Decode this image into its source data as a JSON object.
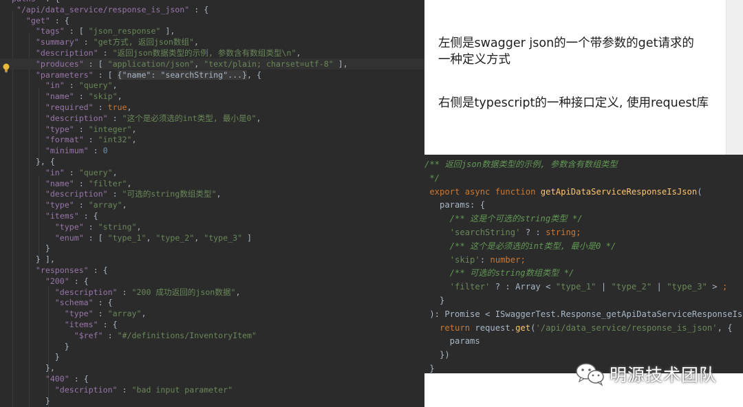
{
  "json_editor": {
    "lines": [
      [
        [
          "k",
          "\"paths\""
        ],
        [
          "p",
          " : {"
        ]
      ],
      [
        [
          "k",
          "  \"/api/data_service/response_is_json\""
        ],
        [
          "p",
          " : {"
        ]
      ],
      [
        [
          "k",
          "    \"get\""
        ],
        [
          "p",
          " : {"
        ]
      ],
      [
        [
          "k",
          "      \"tags\""
        ],
        [
          "p",
          " : [ "
        ],
        [
          "s",
          "\"json_response\""
        ],
        [
          "p",
          " ],"
        ]
      ],
      [
        [
          "k",
          "      \"summary\""
        ],
        [
          "p",
          " : "
        ],
        [
          "s",
          "\"get方式, 返回json数组\""
        ],
        [
          "p",
          ","
        ]
      ],
      [
        [
          "k",
          "      \"description\""
        ],
        [
          "p",
          " : "
        ],
        [
          "s",
          "\"返回json数据类型的示例, 参数含有数组类型\\n\""
        ],
        [
          "p",
          ","
        ]
      ],
      [
        [
          "k",
          "      \"produces\""
        ],
        [
          "p",
          " : [ "
        ],
        [
          "s",
          "\"application/json\""
        ],
        [
          "p",
          ", "
        ],
        [
          "s",
          "\"text/plain; charset=utf-8\""
        ],
        [
          "p",
          " ],"
        ]
      ],
      [
        [
          "k",
          "      \"parameters\""
        ],
        [
          "p",
          " : [ "
        ],
        [
          "f",
          "{\"name\": \"searchString\"...}"
        ],
        [
          "p",
          ", {"
        ]
      ],
      [
        [
          "k",
          "        \"in\""
        ],
        [
          "p",
          " : "
        ],
        [
          "s",
          "\"query\""
        ],
        [
          "p",
          ","
        ]
      ],
      [
        [
          "k",
          "        \"name\""
        ],
        [
          "p",
          " : "
        ],
        [
          "s",
          "\"skip\""
        ],
        [
          "p",
          ","
        ]
      ],
      [
        [
          "k",
          "        \"required\""
        ],
        [
          "p",
          " : "
        ],
        [
          "b",
          "true"
        ],
        [
          "p",
          ","
        ]
      ],
      [
        [
          "k",
          "        \"description\""
        ],
        [
          "p",
          " : "
        ],
        [
          "s",
          "\"这个是必须选的int类型, 最小是0\""
        ],
        [
          "p",
          ","
        ]
      ],
      [
        [
          "k",
          "        \"type\""
        ],
        [
          "p",
          " : "
        ],
        [
          "s",
          "\"integer\""
        ],
        [
          "p",
          ","
        ]
      ],
      [
        [
          "k",
          "        \"format\""
        ],
        [
          "p",
          " : "
        ],
        [
          "s",
          "\"int32\""
        ],
        [
          "p",
          ","
        ]
      ],
      [
        [
          "k",
          "        \"minimum\""
        ],
        [
          "p",
          " : "
        ],
        [
          "n",
          "0"
        ]
      ],
      [
        [
          "p",
          "      }, {"
        ]
      ],
      [
        [
          "k",
          "        \"in\""
        ],
        [
          "p",
          " : "
        ],
        [
          "s",
          "\"query\""
        ],
        [
          "p",
          ","
        ]
      ],
      [
        [
          "k",
          "        \"name\""
        ],
        [
          "p",
          " : "
        ],
        [
          "s",
          "\"filter\""
        ],
        [
          "p",
          ","
        ]
      ],
      [
        [
          "k",
          "        \"description\""
        ],
        [
          "p",
          " : "
        ],
        [
          "s",
          "\"可选的string数组类型\""
        ],
        [
          "p",
          ","
        ]
      ],
      [
        [
          "k",
          "        \"type\""
        ],
        [
          "p",
          " : "
        ],
        [
          "s",
          "\"array\""
        ],
        [
          "p",
          ","
        ]
      ],
      [
        [
          "k",
          "        \"items\""
        ],
        [
          "p",
          " : {"
        ]
      ],
      [
        [
          "k",
          "          \"type\""
        ],
        [
          "p",
          " : "
        ],
        [
          "s",
          "\"string\""
        ],
        [
          "p",
          ","
        ]
      ],
      [
        [
          "k",
          "          \"enum\""
        ],
        [
          "p",
          " : [ "
        ],
        [
          "s",
          "\"type_1\""
        ],
        [
          "p",
          ", "
        ],
        [
          "s",
          "\"type_2\""
        ],
        [
          "p",
          ", "
        ],
        [
          "s",
          "\"type_3\""
        ],
        [
          "p",
          " ]"
        ]
      ],
      [
        [
          "p",
          "        }"
        ]
      ],
      [
        [
          "p",
          "      } ],"
        ]
      ],
      [
        [
          "k",
          "      \"responses\""
        ],
        [
          "p",
          " : {"
        ]
      ],
      [
        [
          "k",
          "        \"200\""
        ],
        [
          "p",
          " : {"
        ]
      ],
      [
        [
          "k",
          "          \"description\""
        ],
        [
          "p",
          " : "
        ],
        [
          "s",
          "\"200 成功返回的json数据\""
        ],
        [
          "p",
          ","
        ]
      ],
      [
        [
          "k",
          "          \"schema\""
        ],
        [
          "p",
          " : {"
        ]
      ],
      [
        [
          "k",
          "            \"type\""
        ],
        [
          "p",
          " : "
        ],
        [
          "s",
          "\"array\""
        ],
        [
          "p",
          ","
        ]
      ],
      [
        [
          "k",
          "            \"items\""
        ],
        [
          "p",
          " : {"
        ]
      ],
      [
        [
          "k",
          "              \"$ref\""
        ],
        [
          "p",
          " : "
        ],
        [
          "s",
          "\"#/definitions/InventoryItem\""
        ]
      ],
      [
        [
          "p",
          "            }"
        ]
      ],
      [
        [
          "p",
          "          }"
        ]
      ],
      [
        [
          "p",
          "        },"
        ]
      ],
      [
        [
          "k",
          "        \"400\""
        ],
        [
          "p",
          " : {"
        ]
      ],
      [
        [
          "k",
          "          \"description\""
        ],
        [
          "p",
          " : "
        ],
        [
          "s",
          "\"bad input parameter\""
        ]
      ],
      [
        [
          "p",
          "        }"
        ]
      ]
    ]
  },
  "notes": {
    "line1": "左侧是swagger json的一个带参数的get请求的",
    "line2": "一种定义方式",
    "line3": "右侧是typescript的一种接口定义, 使用request库"
  },
  "ts_editor": {
    "lines": [
      [
        [
          "c",
          "/** 返回json数据类型的示例, 参数含有数组类型"
        ]
      ],
      [
        [
          "c",
          " */"
        ]
      ],
      [
        [
          "kw",
          " export async function "
        ],
        [
          "fn",
          "getApiDataServiceResponseIsJson"
        ],
        [
          "ty",
          "("
        ]
      ],
      [
        [
          "ty",
          "   params: {"
        ]
      ],
      [
        [
          "c",
          "     /** 这是个可选的string类型 */"
        ]
      ],
      [
        [
          "st",
          "     'searchString'"
        ],
        [
          "ty",
          " ? : "
        ],
        [
          "kw",
          "string"
        ],
        [
          "kw",
          ";"
        ]
      ],
      [
        [
          "c",
          "     /** 这个是必须选的int类型, 最小是0 */"
        ]
      ],
      [
        [
          "st",
          "     'skip'"
        ],
        [
          "ty",
          ": "
        ],
        [
          "kw",
          "number"
        ],
        [
          "kw",
          ";"
        ]
      ],
      [
        [
          "c",
          "     /** 可选的string数组类型 */"
        ]
      ],
      [
        [
          "st",
          "     'filter'"
        ],
        [
          "ty",
          " ? : Array < "
        ],
        [
          "st",
          "\"type_1\""
        ],
        [
          "ty",
          " | "
        ],
        [
          "st",
          "\"type_2\""
        ],
        [
          "ty",
          " | "
        ],
        [
          "st",
          "\"type_3\""
        ],
        [
          "ty",
          " > "
        ],
        [
          "kw",
          ";"
        ]
      ],
      [
        [
          "ty",
          "   }"
        ]
      ],
      [
        [
          "ty",
          " ): Promise < ISwaggerTest.Response_getApiDataServiceResponseIsJson"
        ]
      ],
      [
        [
          "kw",
          "   return "
        ],
        [
          "ty",
          "request."
        ],
        [
          "fn",
          "get"
        ],
        [
          "ty",
          "("
        ],
        [
          "st",
          "'/api/data_service/response_is_json'"
        ],
        [
          "ty",
          ", {"
        ]
      ],
      [
        [
          "ty",
          "     params"
        ]
      ],
      [
        [
          "ty",
          "   })"
        ]
      ],
      [
        [
          "ty",
          " }"
        ]
      ]
    ]
  },
  "watermark": {
    "text": "明源技术团队",
    "icon": "wechat-icon"
  }
}
